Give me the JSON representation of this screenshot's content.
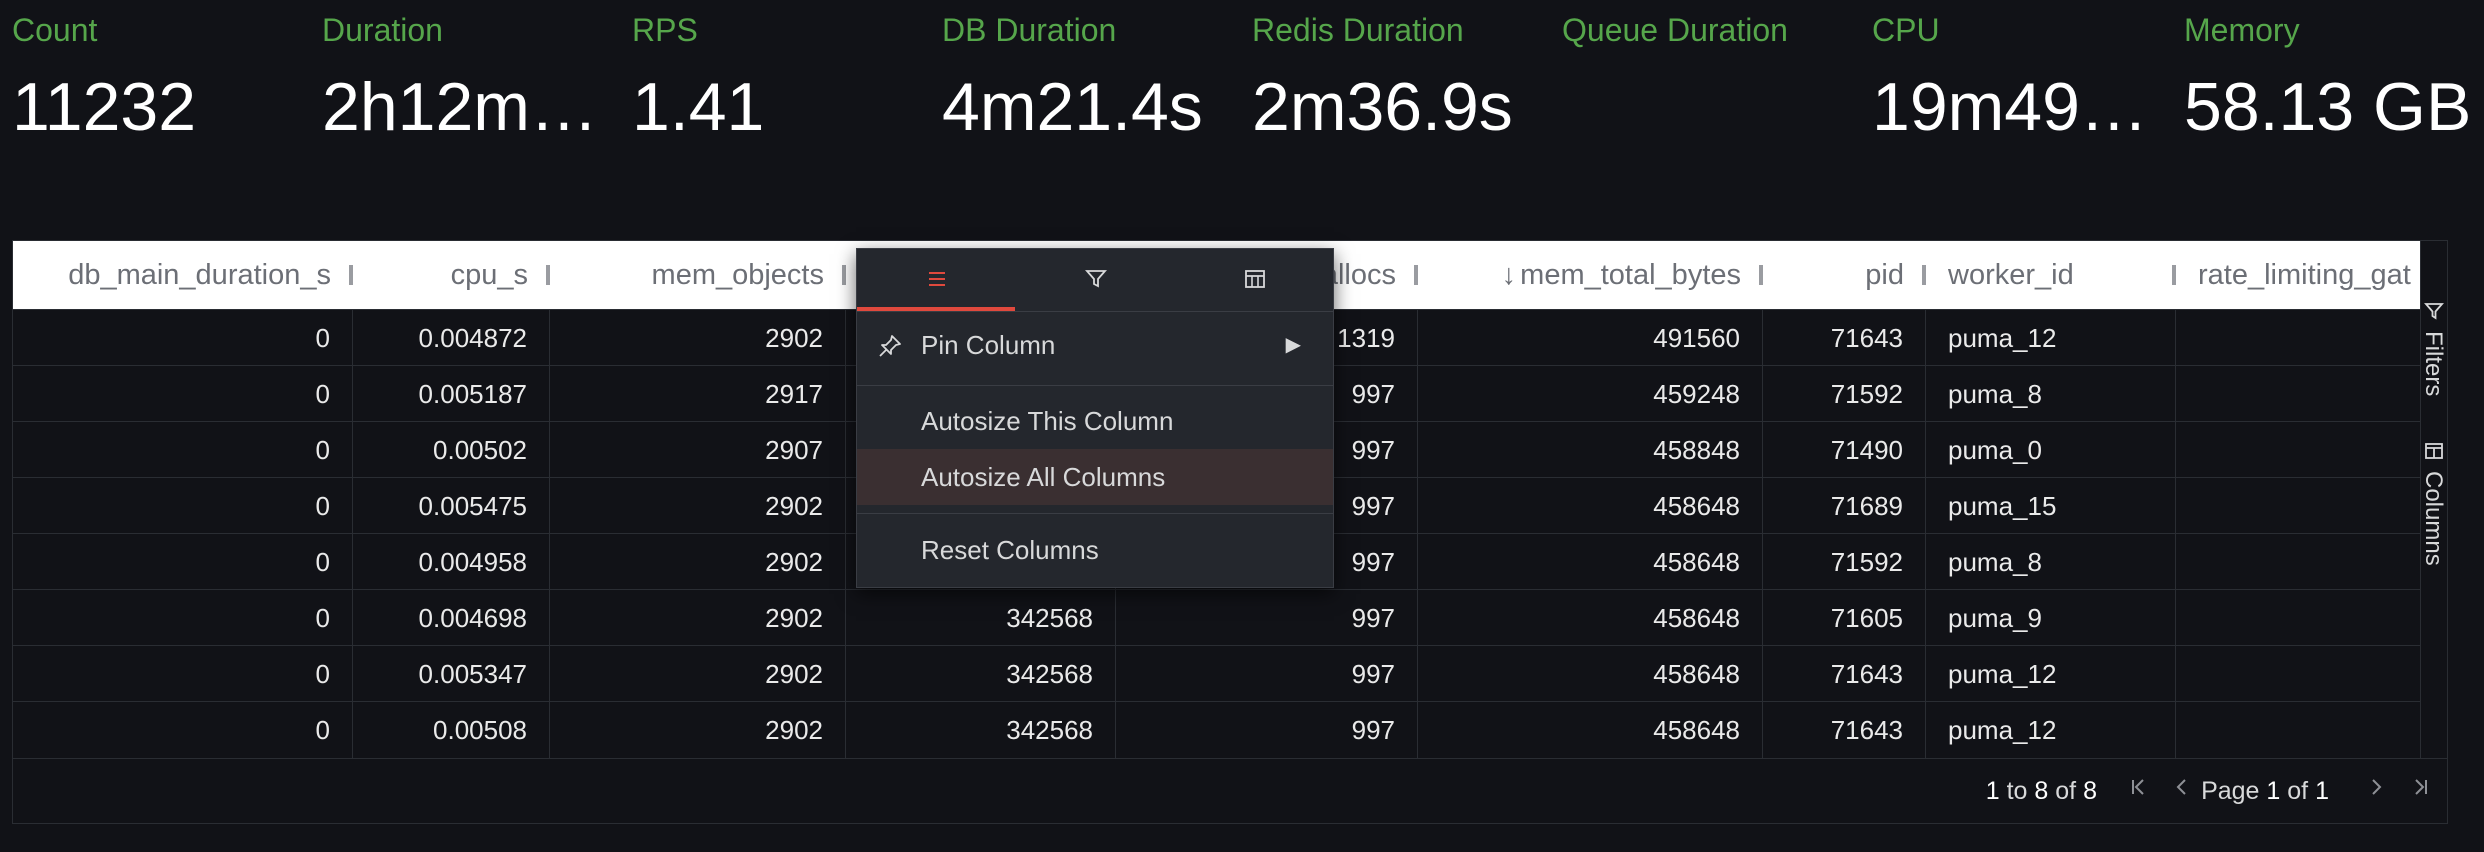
{
  "stats": [
    {
      "label": "Count",
      "value": "11232"
    },
    {
      "label": "Duration",
      "value": "2h12m…"
    },
    {
      "label": "RPS",
      "value": "1.41"
    },
    {
      "label": "DB Duration",
      "value": "4m21.4s"
    },
    {
      "label": "Redis Duration",
      "value": "2m36.9s"
    },
    {
      "label": "Queue Duration",
      "value": ""
    },
    {
      "label": "CPU",
      "value": "19m49…"
    },
    {
      "label": "Memory",
      "value": "58.13 GB"
    }
  ],
  "grid": {
    "columns": [
      "db_main_duration_s",
      "cpu_s",
      "mem_objects",
      "",
      "allocs",
      "mem_total_bytes",
      "pid",
      "worker_id",
      "rate_limiting_gat"
    ],
    "sort_indicator": "↓",
    "rows": [
      [
        "0",
        "0.004872",
        "2902",
        "",
        "1319",
        "491560",
        "71643",
        "puma_12",
        ""
      ],
      [
        "0",
        "0.005187",
        "2917",
        "",
        "997",
        "459248",
        "71592",
        "puma_8",
        ""
      ],
      [
        "0",
        "0.00502",
        "2907",
        "",
        "997",
        "458848",
        "71490",
        "puma_0",
        ""
      ],
      [
        "0",
        "0.005475",
        "2902",
        "",
        "997",
        "458648",
        "71689",
        "puma_15",
        ""
      ],
      [
        "0",
        "0.004958",
        "2902",
        "",
        "997",
        "458648",
        "71592",
        "puma_8",
        ""
      ],
      [
        "0",
        "0.004698",
        "2902",
        "342568",
        "997",
        "458648",
        "71605",
        "puma_9",
        ""
      ],
      [
        "0",
        "0.005347",
        "2902",
        "342568",
        "997",
        "458648",
        "71643",
        "puma_12",
        ""
      ],
      [
        "0",
        "0.00508",
        "2902",
        "342568",
        "997",
        "458648",
        "71643",
        "puma_12",
        ""
      ]
    ],
    "pagination": {
      "from": "1",
      "to_word": "to",
      "to": "8",
      "of_word": "of",
      "total": "8",
      "page_word": "Page",
      "page": "1",
      "page_of": "of",
      "pages": "1"
    }
  },
  "sidebar": {
    "filters": "Filters",
    "columns": "Columns"
  },
  "menu": {
    "tabs": [
      "menu-icon",
      "filter-icon",
      "columns-icon"
    ],
    "items": {
      "pin": "Pin Column",
      "autosize_this": "Autosize This Column",
      "autosize_all": "Autosize All Columns",
      "reset": "Reset Columns"
    }
  },
  "colors": {
    "stat_label": "#56a64b",
    "accent": "#e0493d",
    "background": "#111217"
  }
}
